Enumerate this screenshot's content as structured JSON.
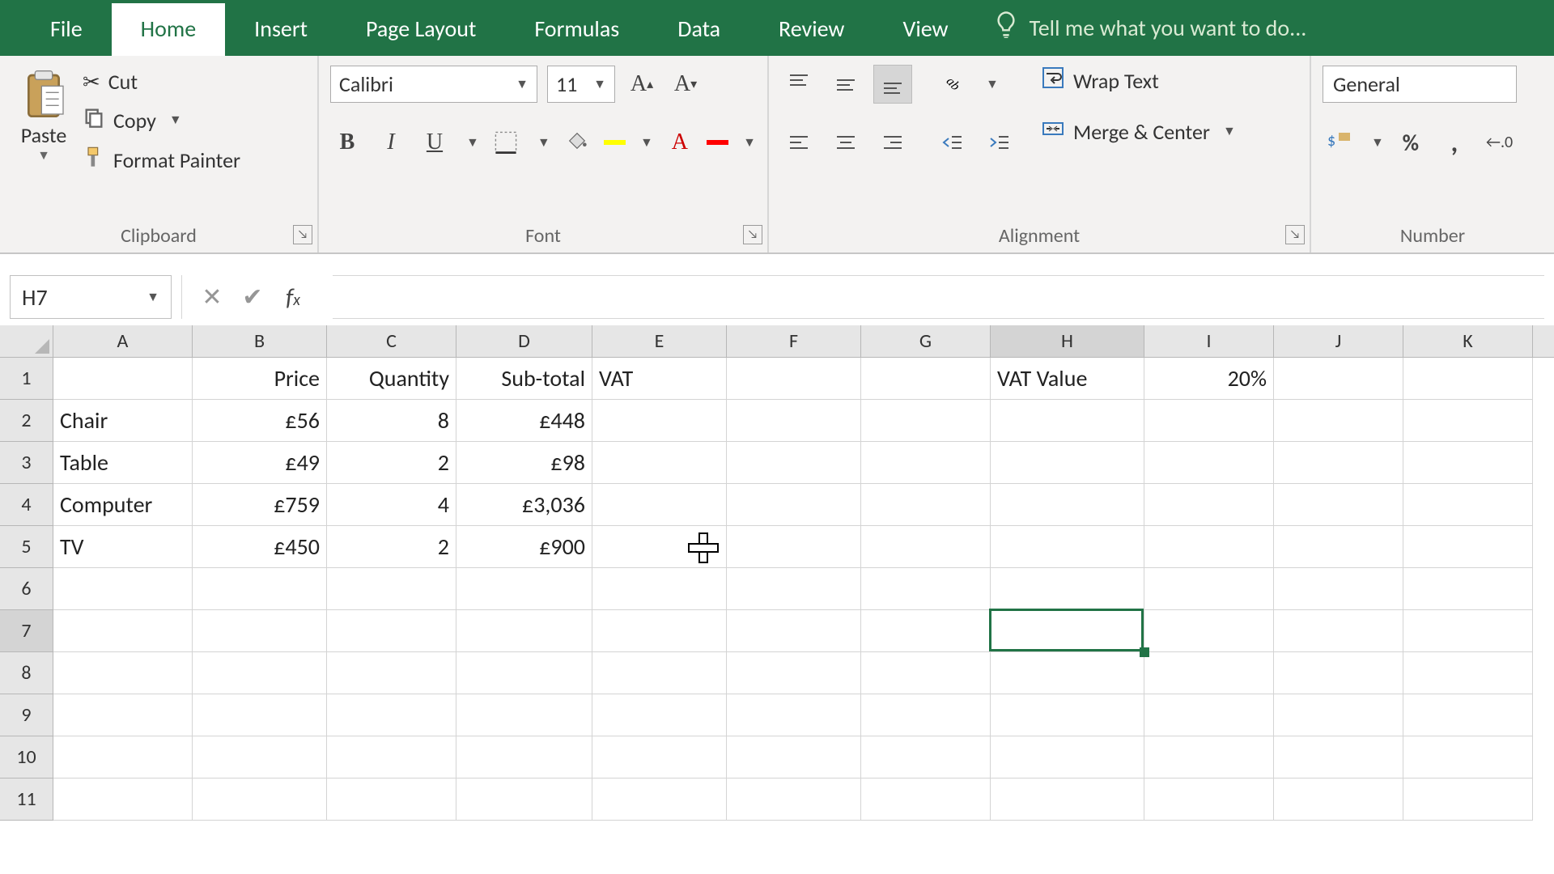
{
  "tabs": {
    "file": "File",
    "home": "Home",
    "insert": "Insert",
    "pagelayout": "Page Layout",
    "formulas": "Formulas",
    "data": "Data",
    "review": "Review",
    "view": "View",
    "tellme": "Tell me what you want to do..."
  },
  "ribbon": {
    "clipboard": {
      "paste": "Paste",
      "cut": "Cut",
      "copy": "Copy",
      "formatpainter": "Format Painter",
      "label": "Clipboard"
    },
    "font": {
      "name": "Calibri",
      "size": "11",
      "label": "Font"
    },
    "alignment": {
      "wrap": "Wrap Text",
      "merge": "Merge & Center",
      "label": "Alignment"
    },
    "number": {
      "format": "General",
      "percent": "%",
      "comma": ",",
      "label": "Number"
    }
  },
  "formula_bar": {
    "namebox": "H7",
    "formula": ""
  },
  "columns": [
    "A",
    "B",
    "C",
    "D",
    "E",
    "F",
    "G",
    "H",
    "I",
    "J",
    "K"
  ],
  "rows": [
    "1",
    "2",
    "3",
    "4",
    "5",
    "6",
    "7",
    "8",
    "9",
    "10",
    "11"
  ],
  "selected": {
    "col": "H",
    "row": "7"
  },
  "cells": {
    "B1": "Price",
    "C1": "Quantity",
    "D1": "Sub-total",
    "E1": "VAT",
    "H1": "VAT Value",
    "I1": "20%",
    "A2": "Chair",
    "B2": "£56",
    "C2": "8",
    "D2": "£448",
    "A3": "Table",
    "B3": "£49",
    "C3": "2",
    "D3": "£98",
    "A4": "Computer",
    "B4": "£759",
    "C4": "4",
    "D4": "£3,036",
    "A5": "TV",
    "B5": "£450",
    "C5": "2",
    "D5": "£900"
  },
  "chart_data": {
    "type": "table",
    "columns": [
      "Item",
      "Price",
      "Quantity",
      "Sub-total",
      "VAT"
    ],
    "rows": [
      {
        "Item": "Chair",
        "Price": 56,
        "Quantity": 8,
        "Sub-total": 448,
        "VAT": null
      },
      {
        "Item": "Table",
        "Price": 49,
        "Quantity": 2,
        "Sub-total": 98,
        "VAT": null
      },
      {
        "Item": "Computer",
        "Price": 759,
        "Quantity": 4,
        "Sub-total": 3036,
        "VAT": null
      },
      {
        "Item": "TV",
        "Price": 450,
        "Quantity": 2,
        "Sub-total": 900,
        "VAT": null
      }
    ],
    "extra": {
      "VAT Value": 0.2
    },
    "currency": "GBP"
  }
}
